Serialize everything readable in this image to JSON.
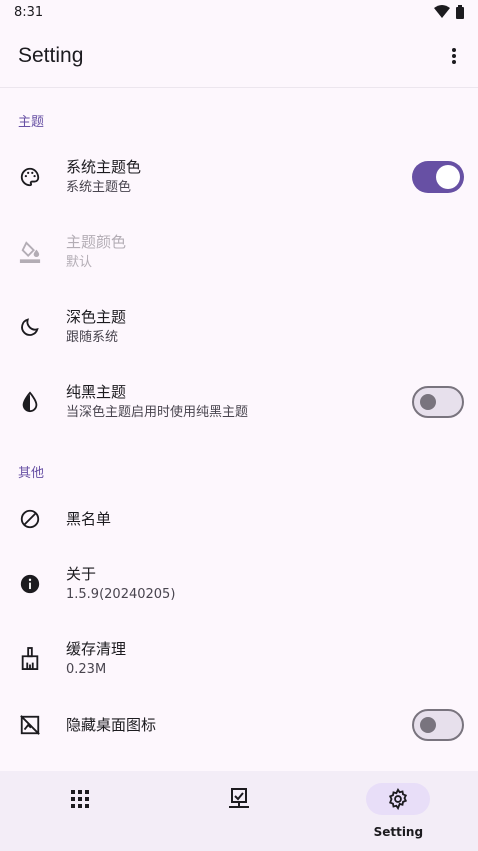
{
  "status_bar": {
    "time": "8:31"
  },
  "app_bar": {
    "title": "Setting"
  },
  "sections": {
    "theme_header": "主题",
    "other_header": "其他"
  },
  "items": {
    "system_theme_color": {
      "title": "系统主题色",
      "summary": "系统主题色",
      "toggle": true
    },
    "theme_color": {
      "title": "主题颜色",
      "summary": "默认",
      "disabled": true
    },
    "dark_theme": {
      "title": "深色主题",
      "summary": "跟随系统"
    },
    "pure_black": {
      "title": "纯黑主题",
      "summary": "当深色主题启用时使用纯黑主题",
      "toggle": false
    },
    "blacklist": {
      "title": "黑名单"
    },
    "about": {
      "title": "关于",
      "summary": "1.5.9(20240205)"
    },
    "cache_clear": {
      "title": "缓存清理",
      "summary": "0.23M"
    },
    "hide_icon": {
      "title": "隐藏桌面图标",
      "toggle": false
    }
  },
  "bottom_nav": {
    "items": [
      {
        "icon": "apps-grid-icon",
        "label": ""
      },
      {
        "icon": "task-check-icon",
        "label": ""
      },
      {
        "icon": "gear-icon",
        "label": "Setting",
        "active": true
      }
    ]
  },
  "colors": {
    "accent": "#6750a4",
    "background": "#fdf7fd",
    "nav_background": "#f3edf7",
    "pill": "#e8def8"
  }
}
